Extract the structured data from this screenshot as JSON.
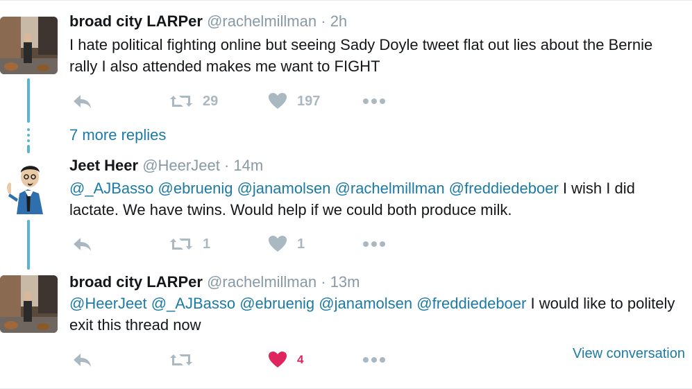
{
  "tweets": [
    {
      "name": "broad city LARPer",
      "handle": "@rachelmillman",
      "sep": "·",
      "time": "2h",
      "text": "I hate political fighting online but seeing Sady Doyle tweet flat out lies about the Bernie rally I also attended makes me want to FIGHT",
      "retweets": "29",
      "likes": "197"
    },
    {
      "name": "Jeet Heer",
      "handle": "@HeerJeet",
      "sep": "·",
      "time": "14m",
      "mentions": "@_AJBasso @ebruenig @janamolsen @rachelmillman @freddiedeboer",
      "text": " I wish I did lactate. We have twins. Would help if we could both produce milk.",
      "retweets": "1",
      "likes": "1"
    },
    {
      "name": "broad city LARPer",
      "handle": "@rachelmillman",
      "sep": "·",
      "time": "13m",
      "mentions": "@HeerJeet @_AJBasso @ebruenig @janamolsen @freddiedeboer",
      "text": " I would like to politely exit this thread now",
      "retweets": "",
      "likes": "4"
    }
  ],
  "more_replies_label": "7 more replies",
  "view_conversation_label": "View conversation",
  "icons": {
    "reply": "reply-icon",
    "retweet": "retweet-icon",
    "like": "heart-icon",
    "more": "more-icon"
  },
  "colors": {
    "link": "#1b7aa6",
    "thread_line": "#58b6d1",
    "icon_gray": "#aab8c2",
    "like_red": "#e0245e"
  }
}
